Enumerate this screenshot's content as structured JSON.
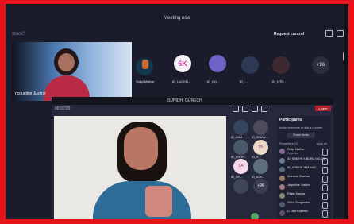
{
  "window_title": "Meeting now",
  "header": {
    "left_hint": "stack?",
    "request_control": "Request control"
  },
  "main_participant": {
    "name": "ncqueline Justine"
  },
  "top_tiles": {
    "bubble_6k": "6K",
    "more_count": "+96",
    "labels": [
      "Shilpi Mathur",
      "ID_LUCKN...",
      "ID_KO...",
      "ID_...",
      "ID_KTR..."
    ]
  },
  "laptop": {
    "title": "SUNIDHI GUNECH",
    "time": "00:00:00",
    "leave": "Leave"
  },
  "side_grid": {
    "gt4": "6K",
    "gt5": "SA",
    "gt8": "+96",
    "labels": [
      "ID_ANM...",
      "ID_IBRAN...",
      "ID_BHOP...",
      "ID_S...",
      "ID_NIT...",
      "ID_AJA..."
    ]
  },
  "participants": {
    "title": "Participants",
    "search_placeholder": "Invite someone or dial a number",
    "share_button": "Share invite",
    "presenters_label": "Presenters (3)",
    "mute_all": "Mute all",
    "rows": [
      {
        "name": "Shilpi Mathur",
        "role": "Organizer"
      },
      {
        "name": "ID_SANTHI KIBURU NIGER",
        "role": ""
      },
      {
        "name": "ID_ASBANI MATHUR",
        "role": ""
      },
      {
        "name": "Archana Sharma",
        "role": ""
      },
      {
        "name": "Jaqueline Justine",
        "role": ""
      },
      {
        "name": "Rajan Sachar",
        "role": ""
      },
      {
        "name": "Vishu Sangeetha",
        "role": ""
      },
      {
        "name": "G Devi Kaberthi",
        "role": ""
      }
    ]
  },
  "colors": {
    "border": "#e8121a",
    "teams_dark": "#1b1c2b",
    "accent_pink": "#c1439c"
  }
}
